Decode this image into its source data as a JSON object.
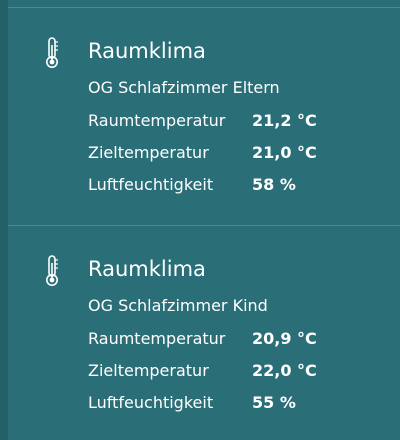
{
  "cards": [
    {
      "icon": "thermometer-icon",
      "title": "Raumklima",
      "subtitle": "OG Schlafzimmer Eltern",
      "rows": [
        {
          "label": "Raumtemperatur",
          "value": "21,2 °C"
        },
        {
          "label": "Zieltemperatur",
          "value": "21,0 °C"
        },
        {
          "label": "Luftfeuchtigkeit",
          "value": "58 %"
        }
      ]
    },
    {
      "icon": "thermometer-icon",
      "title": "Raumklima",
      "subtitle": "OG Schlafzimmer Kind",
      "rows": [
        {
          "label": "Raumtemperatur",
          "value": "20,9 °C"
        },
        {
          "label": "Zieltemperatur",
          "value": "22,0 °C"
        },
        {
          "label": "Luftfeuchtigkeit",
          "value": "55 %"
        }
      ]
    }
  ],
  "colors": {
    "panel": "#2a6f78",
    "edge": "#235f67",
    "divider": "#4c8a92",
    "text": "#ffffff"
  }
}
